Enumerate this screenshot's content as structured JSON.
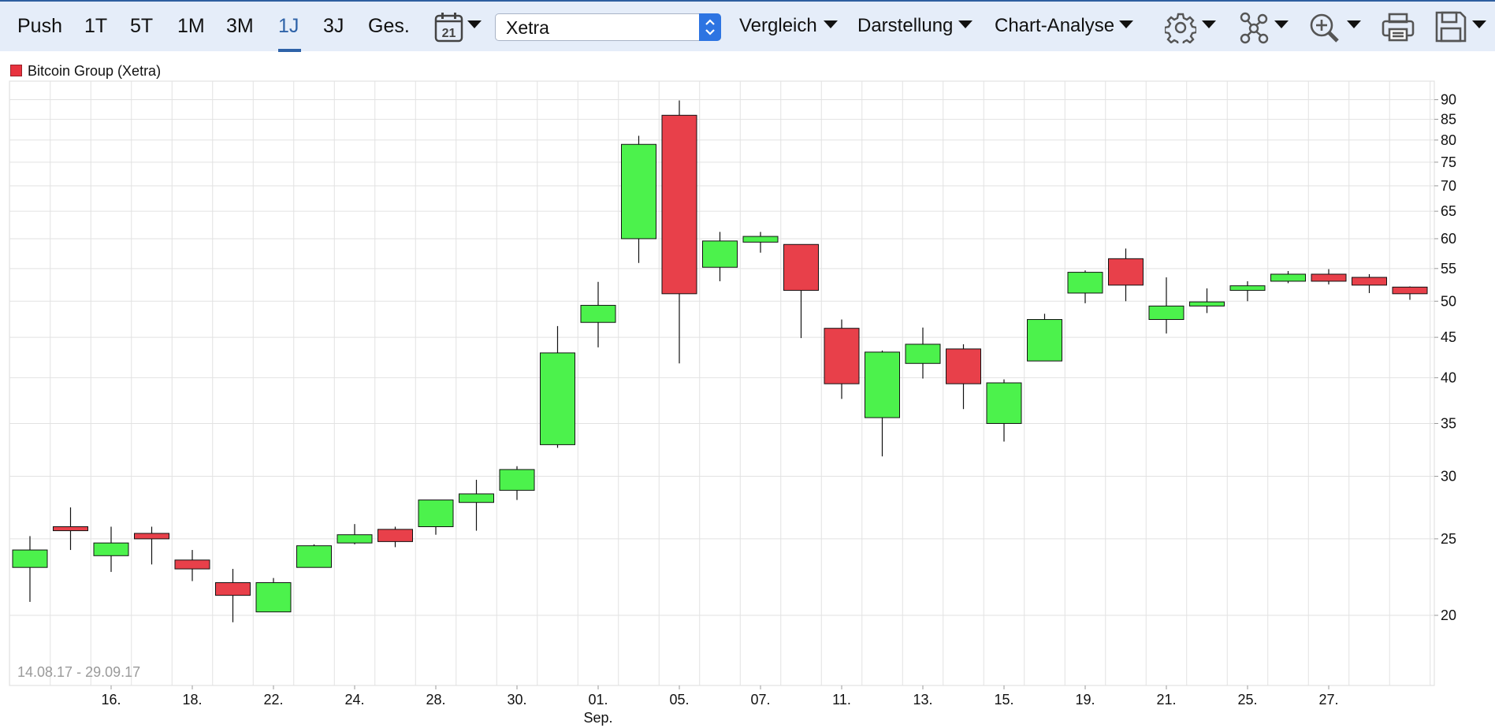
{
  "toolbar": {
    "range_tabs": [
      "Push",
      "1T",
      "5T",
      "1M",
      "3M",
      "1J",
      "3J",
      "Ges."
    ],
    "active_tab": "1J",
    "calendar_day": "21",
    "exchange": "Xetra",
    "menus": [
      "Vergleich",
      "Darstellung",
      "Chart-Analyse"
    ],
    "icons": [
      "calendar-icon",
      "gear-icon",
      "indicators-icon",
      "zoom-in-icon",
      "print-icon",
      "save-icon"
    ]
  },
  "legend": {
    "label": "Bitcoin Group (Xetra)"
  },
  "date_range": "14.08.17 - 29.09.17",
  "colors": {
    "up": "#4cf24c",
    "down": "#e8404a",
    "accent": "#2f63a8"
  },
  "chart_data": {
    "type": "candlestick",
    "series_name": "Bitcoin Group (Xetra)",
    "y_scale": "log",
    "yticks": [
      20,
      25,
      30,
      35,
      40,
      45,
      50,
      55,
      60,
      65,
      70,
      75,
      80,
      85,
      90
    ],
    "ylim": [
      16.3,
      95
    ],
    "xticks": [
      {
        "index": 2,
        "label": "16."
      },
      {
        "index": 4,
        "label": "18."
      },
      {
        "index": 6,
        "label": "22."
      },
      {
        "index": 8,
        "label": "24."
      },
      {
        "index": 10,
        "label": "28."
      },
      {
        "index": 12,
        "label": "30."
      },
      {
        "index": 14,
        "label": "01.",
        "sublabel": "Sep."
      },
      {
        "index": 16,
        "label": "05."
      },
      {
        "index": 18,
        "label": "07."
      },
      {
        "index": 20,
        "label": "11."
      },
      {
        "index": 22,
        "label": "13."
      },
      {
        "index": 24,
        "label": "15."
      },
      {
        "index": 26,
        "label": "19."
      },
      {
        "index": 28,
        "label": "21."
      },
      {
        "index": 30,
        "label": "25."
      },
      {
        "index": 32,
        "label": "27."
      }
    ],
    "candles": [
      {
        "o": 23.0,
        "h": 25.2,
        "l": 20.8,
        "c": 24.2
      },
      {
        "o": 25.9,
        "h": 27.4,
        "l": 24.2,
        "c": 25.6
      },
      {
        "o": 23.8,
        "h": 25.9,
        "l": 22.7,
        "c": 24.7
      },
      {
        "o": 25.4,
        "h": 25.9,
        "l": 23.2,
        "c": 25.0
      },
      {
        "o": 23.5,
        "h": 24.2,
        "l": 22.1,
        "c": 22.9
      },
      {
        "o": 22.0,
        "h": 22.9,
        "l": 19.6,
        "c": 21.2
      },
      {
        "o": 20.2,
        "h": 22.3,
        "l": 20.2,
        "c": 22.0
      },
      {
        "o": 23.0,
        "h": 24.6,
        "l": 23.0,
        "c": 24.5
      },
      {
        "o": 24.7,
        "h": 26.1,
        "l": 24.6,
        "c": 25.3
      },
      {
        "o": 25.7,
        "h": 25.9,
        "l": 24.4,
        "c": 24.8
      },
      {
        "o": 25.9,
        "h": 28.0,
        "l": 25.3,
        "c": 28.0
      },
      {
        "o": 27.8,
        "h": 29.7,
        "l": 25.6,
        "c": 28.5
      },
      {
        "o": 28.8,
        "h": 30.9,
        "l": 28.0,
        "c": 30.6
      },
      {
        "o": 32.9,
        "h": 46.5,
        "l": 32.6,
        "c": 43.0
      },
      {
        "o": 47.0,
        "h": 52.9,
        "l": 43.7,
        "c": 49.4
      },
      {
        "o": 60.0,
        "h": 81.0,
        "l": 55.9,
        "c": 79.0
      },
      {
        "o": 86.0,
        "h": 89.8,
        "l": 41.7,
        "c": 51.1
      },
      {
        "o": 55.2,
        "h": 61.2,
        "l": 53.0,
        "c": 59.6
      },
      {
        "o": 59.4,
        "h": 61.2,
        "l": 57.6,
        "c": 60.4
      },
      {
        "o": 59.0,
        "h": 59.0,
        "l": 44.9,
        "c": 51.6
      },
      {
        "o": 46.2,
        "h": 47.4,
        "l": 37.6,
        "c": 39.3
      },
      {
        "o": 35.6,
        "h": 43.3,
        "l": 31.8,
        "c": 43.1
      },
      {
        "o": 41.7,
        "h": 46.3,
        "l": 39.9,
        "c": 44.1
      },
      {
        "o": 43.5,
        "h": 44.1,
        "l": 36.5,
        "c": 39.3
      },
      {
        "o": 35.0,
        "h": 39.8,
        "l": 33.2,
        "c": 39.4
      },
      {
        "o": 42.0,
        "h": 48.2,
        "l": 42.0,
        "c": 47.4
      },
      {
        "o": 51.2,
        "h": 54.7,
        "l": 49.7,
        "c": 54.4
      },
      {
        "o": 56.6,
        "h": 58.3,
        "l": 50.0,
        "c": 52.4
      },
      {
        "o": 47.4,
        "h": 53.6,
        "l": 45.5,
        "c": 49.3
      },
      {
        "o": 49.3,
        "h": 51.9,
        "l": 48.3,
        "c": 49.9
      },
      {
        "o": 51.6,
        "h": 53.0,
        "l": 50.0,
        "c": 52.3
      },
      {
        "o": 53.0,
        "h": 54.6,
        "l": 52.7,
        "c": 54.1
      },
      {
        "o": 54.1,
        "h": 54.9,
        "l": 52.5,
        "c": 53.0
      },
      {
        "o": 53.6,
        "h": 54.1,
        "l": 51.2,
        "c": 52.4
      },
      {
        "o": 52.1,
        "h": 52.2,
        "l": 50.2,
        "c": 51.1
      }
    ]
  }
}
